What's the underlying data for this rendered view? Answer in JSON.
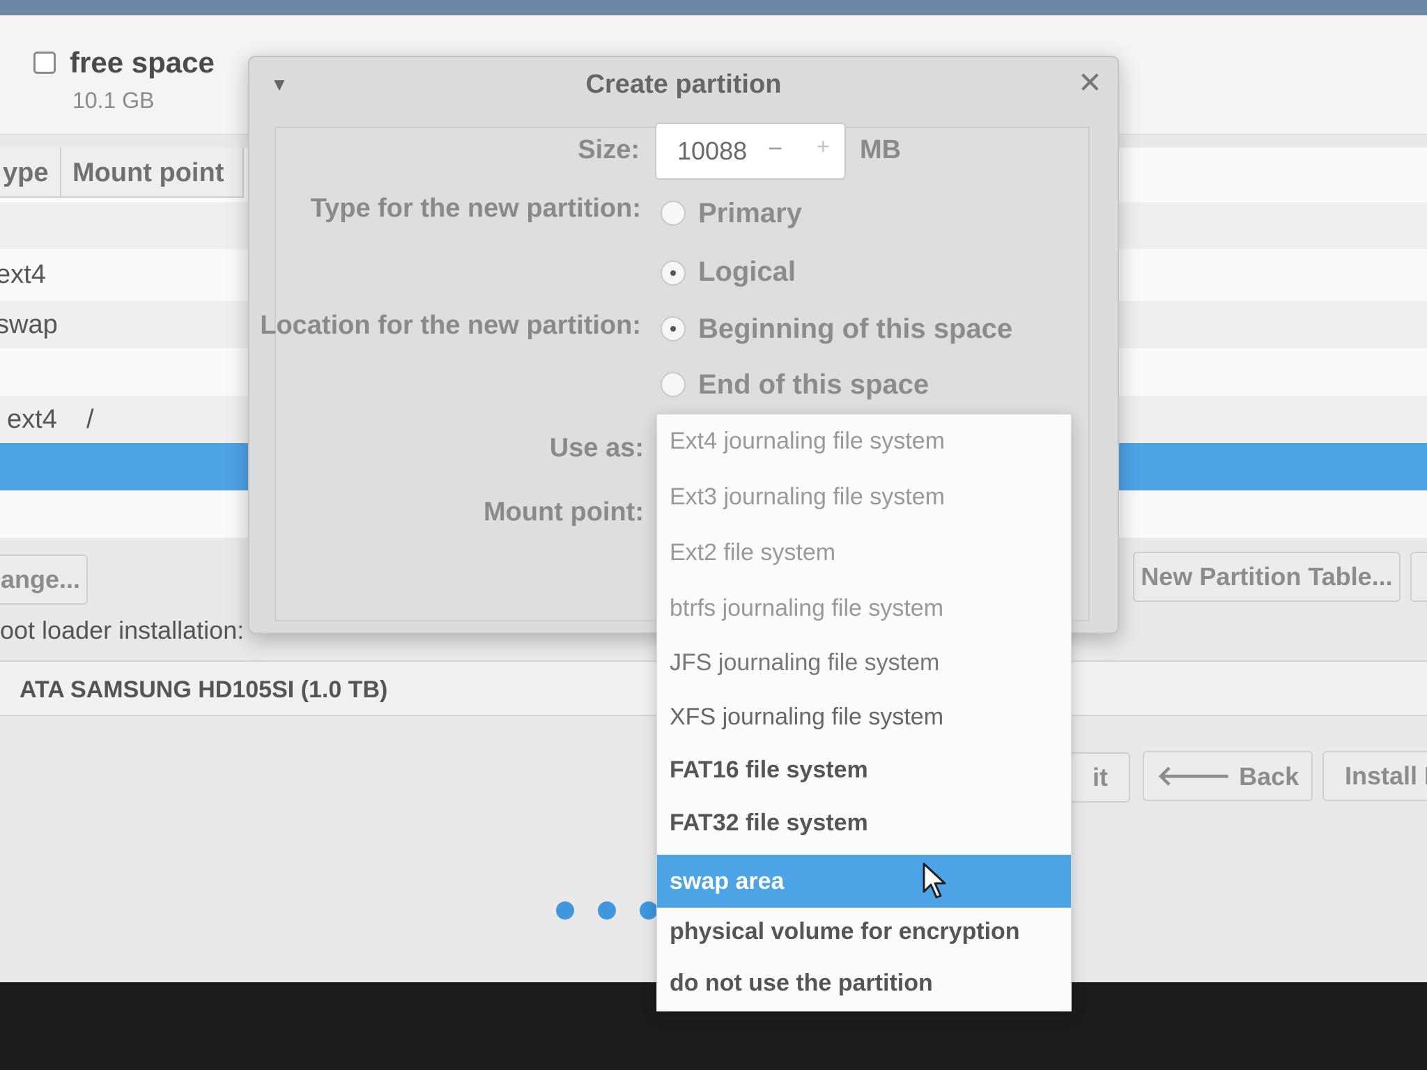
{
  "background": {
    "free_space": {
      "title": "free space",
      "size": "10.1 GB"
    },
    "table": {
      "columns": [
        "ype",
        "Mount point"
      ],
      "rows": [
        {
          "type": "",
          "mount": ""
        },
        {
          "type": "ext4",
          "mount": ""
        },
        {
          "type": "swap",
          "mount": ""
        },
        {
          "type": "",
          "mount": ""
        },
        {
          "type": "ext4",
          "mount": "/"
        }
      ]
    },
    "change_button": "ange...",
    "new_partition_table_button": "New Partition Table...",
    "boot_loader_label": "oot loader installation:",
    "boot_loader_device": "ATA SAMSUNG HD105SI (1.0 TB)",
    "quit_button": "it",
    "back_button": "Back",
    "install_button": "Install N"
  },
  "dialog": {
    "title": "Create partition",
    "menu_icon": "triangle-down-icon",
    "close_icon": "close-icon",
    "size": {
      "label": "Size:",
      "value": "10088",
      "minus": "−",
      "plus": "+",
      "unit": "MB"
    },
    "type": {
      "label": "Type for the new partition:",
      "options": [
        {
          "label": "Primary",
          "checked": false
        },
        {
          "label": "Logical",
          "checked": true
        }
      ]
    },
    "location": {
      "label": "Location for the new partition:",
      "options": [
        {
          "label": "Beginning of this space",
          "checked": true
        },
        {
          "label": "End of this space",
          "checked": false
        }
      ]
    },
    "use_as_label": "Use as:",
    "mount_point_label": "Mount point:"
  },
  "use_as_dropdown": {
    "items": [
      "Ext4 journaling file system",
      "Ext3 journaling file system",
      "Ext2 file system",
      "btrfs journaling file system",
      "JFS journaling file system",
      "XFS journaling file system",
      "FAT16 file system",
      "FAT32 file system",
      "swap area",
      "physical volume for encryption",
      "do not use the partition"
    ],
    "selected": "swap area"
  },
  "colors": {
    "selection": "#4ca3e6",
    "progress_dots": "#3f97dd"
  }
}
